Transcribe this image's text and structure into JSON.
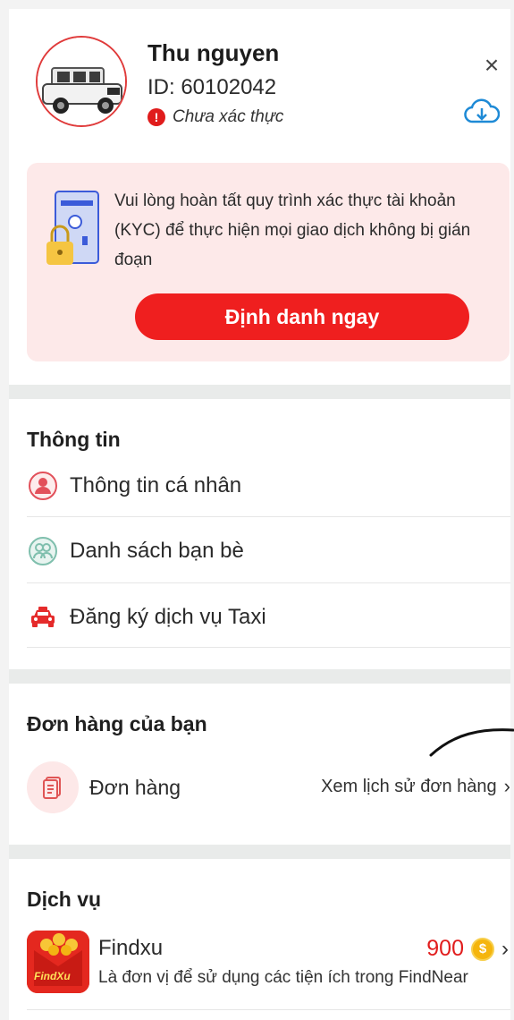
{
  "profile": {
    "name": "Thu nguyen",
    "id_text": "ID: 60102042",
    "verify_status": "Chưa xác thực"
  },
  "kyc": {
    "message": "Vui lòng hoàn tất quy trình xác thực tài khoản (KYC) để thực hiện mọi giao dịch không bị gián đoạn",
    "button_label": "Định danh ngay"
  },
  "info_section": {
    "title": "Thông tin",
    "items": [
      {
        "label": "Thông tin cá nhân",
        "icon": "person-icon"
      },
      {
        "label": "Danh sách bạn bè",
        "icon": "friends-icon"
      },
      {
        "label": "Đăng ký dịch vụ Taxi",
        "icon": "taxi-icon"
      }
    ]
  },
  "orders_section": {
    "title": "Đơn hàng của bạn",
    "item_label": "Đơn hàng",
    "history_link": "Xem lịch sử đơn hàng"
  },
  "services_section": {
    "title": "Dịch vụ",
    "service": {
      "name": "Findxu",
      "description": "Là đơn vị để sử dụng các tiện ích trong FindNear",
      "coins": "900",
      "logo_text": "FindXu"
    }
  },
  "colors": {
    "accent": "#ef1f1f",
    "kyc_bg": "#fde9e9",
    "separator": "#e9ebea"
  }
}
